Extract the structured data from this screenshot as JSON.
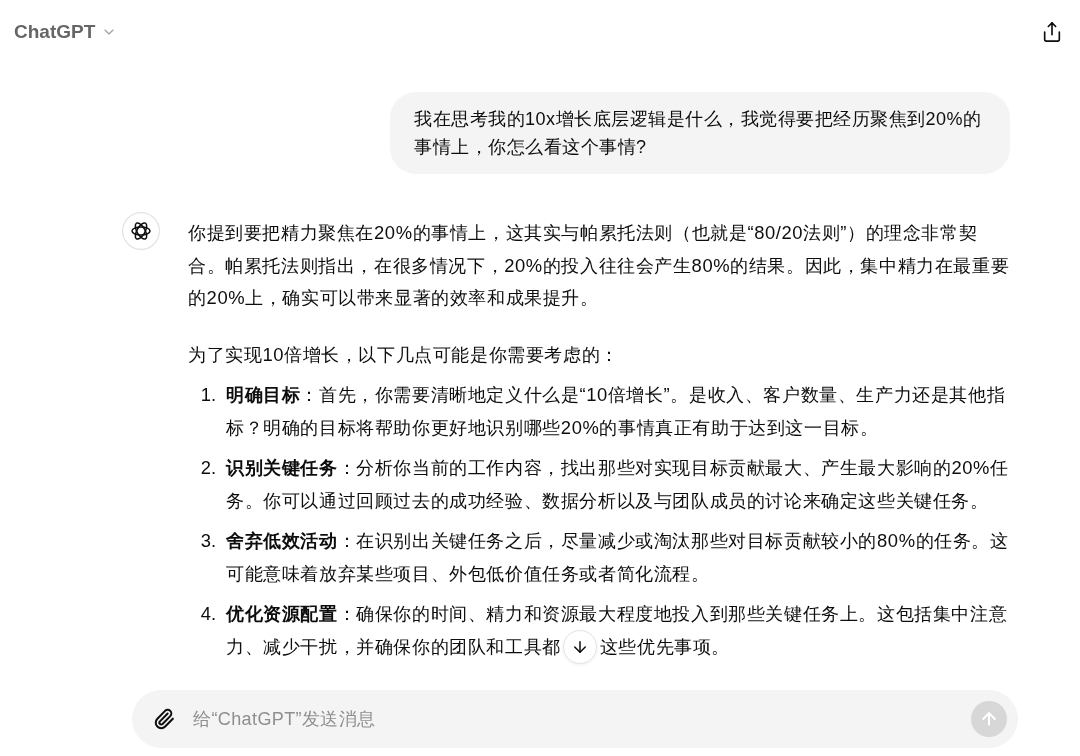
{
  "header": {
    "title": "ChatGPT"
  },
  "conversation": [
    {
      "kind": "user_message",
      "text": "我在思考我的10x增长底层逻辑是什么，我觉得要把经历聚焦到20%的事情上，你怎么看这个事情?"
    },
    {
      "kind": "assistant_message",
      "blocks": [
        {
          "kind": "paragraph",
          "text": "你提到要把精力聚焦在20%的事情上，这其实与帕累托法则（也就是“80/20法则”）的理念非常契合。帕累托法则指出，在很多情况下，20%的投入往往会产生80%的结果。因此，集中精力在最重要的20%上，确实可以带来显著的效率和成果提升。"
        },
        {
          "kind": "paragraph",
          "text": "为了实现10倍增长，以下几点可能是你需要考虑的："
        },
        {
          "kind": "numbered_list",
          "items": [
            {
              "kind": "plain",
              "number": "1.",
              "text": "**明确目标**：首先，你需要清晰地定义什么是“10倍增长”。是收入、客户数量、生产力还是其他指标？明确的目标将帮助你更好地识别哪些20%的事情真正有助于达到这一目标。"
            },
            {
              "kind": "plain",
              "number": "2.",
              "text": "**识别关键任务**：分析你当前的工作内容，找出那些对实现目标贡献最大、产生最大影响的20%任务。你可以通过回顾过去的成功经验、数据分析以及与团队成员的讨论来确定这些关键任务。"
            },
            {
              "kind": "plain",
              "number": "3.",
              "text": "**舍弃低效活动**：在识别出关键任务之后，尽量减少或淘汰那些对目标贡献较小的80%的任务。这可能意味着放弃某些项目、外包低价值任务或者简化流程。"
            },
            {
              "kind": "overlaid",
              "number": "4.",
              "text": "**优化资源配置**：确保你的时间、精力和资源最大程度地投入到那些关键任务上。这包括集中注意",
              "text_before_button": "力、减少干扰，并确保你的团队和工具都",
              "text_after_button": "这些优先事项。"
            }
          ]
        }
      ]
    }
  ],
  "composer": {
    "placeholder": "给“ChatGPT”发送消息",
    "send_disabled": true
  }
}
